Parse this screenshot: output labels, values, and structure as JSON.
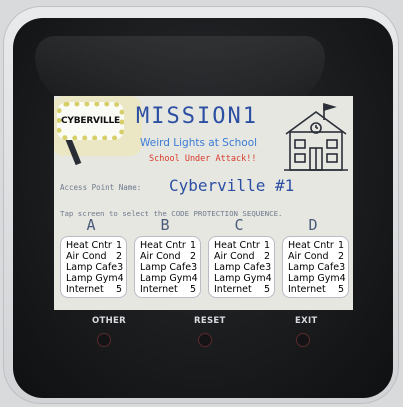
{
  "sign": {
    "text": "CYBERVILLE"
  },
  "header": {
    "title": "MISSION1",
    "subtitle": "Weird Lights at School",
    "alert": "School Under Attack!!"
  },
  "access_point": {
    "label": "Access Point Name:",
    "value": "Cyberville #1"
  },
  "instruction": "Tap screen to select the CODE PROTECTION SEQUENCE.",
  "columns": [
    {
      "letter": "A",
      "items": [
        {
          "name": "Heat Cntr",
          "num": "1"
        },
        {
          "name": "Air Cond",
          "num": "2"
        },
        {
          "name": "Lamp Cafe",
          "num": "3"
        },
        {
          "name": "Lamp Gym",
          "num": "4"
        },
        {
          "name": "Internet",
          "num": "5"
        }
      ]
    },
    {
      "letter": "B",
      "items": [
        {
          "name": "Heat Cntr",
          "num": "1"
        },
        {
          "name": "Air Cond",
          "num": "2"
        },
        {
          "name": "Lamp Cafe",
          "num": "3"
        },
        {
          "name": "Lamp Gym",
          "num": "4"
        },
        {
          "name": "Internet",
          "num": "5"
        }
      ]
    },
    {
      "letter": "C",
      "items": [
        {
          "name": "Heat Cntr",
          "num": "1"
        },
        {
          "name": "Air Cond",
          "num": "2"
        },
        {
          "name": "Lamp Cafe",
          "num": "3"
        },
        {
          "name": "Lamp Gym",
          "num": "4"
        },
        {
          "name": "Internet",
          "num": "5"
        }
      ]
    },
    {
      "letter": "D",
      "items": [
        {
          "name": "Heat Cntr",
          "num": "1"
        },
        {
          "name": "Air Cond",
          "num": "2"
        },
        {
          "name": "Lamp Cafe",
          "num": "3"
        },
        {
          "name": "Lamp Gym",
          "num": "4"
        },
        {
          "name": "Internet",
          "num": "5"
        }
      ]
    }
  ],
  "softkeys": {
    "left": "OTHER",
    "center": "RESET",
    "right": "EXIT"
  },
  "icons": {
    "sign": "cyberville-sign-icon",
    "school": "school-building-icon"
  },
  "colors": {
    "title": "#2c4fa3",
    "subtitle": "#3a7bd5",
    "alert": "#d93a2a",
    "screen_bg": "#e7e7e2",
    "bezel": "#17181a"
  }
}
